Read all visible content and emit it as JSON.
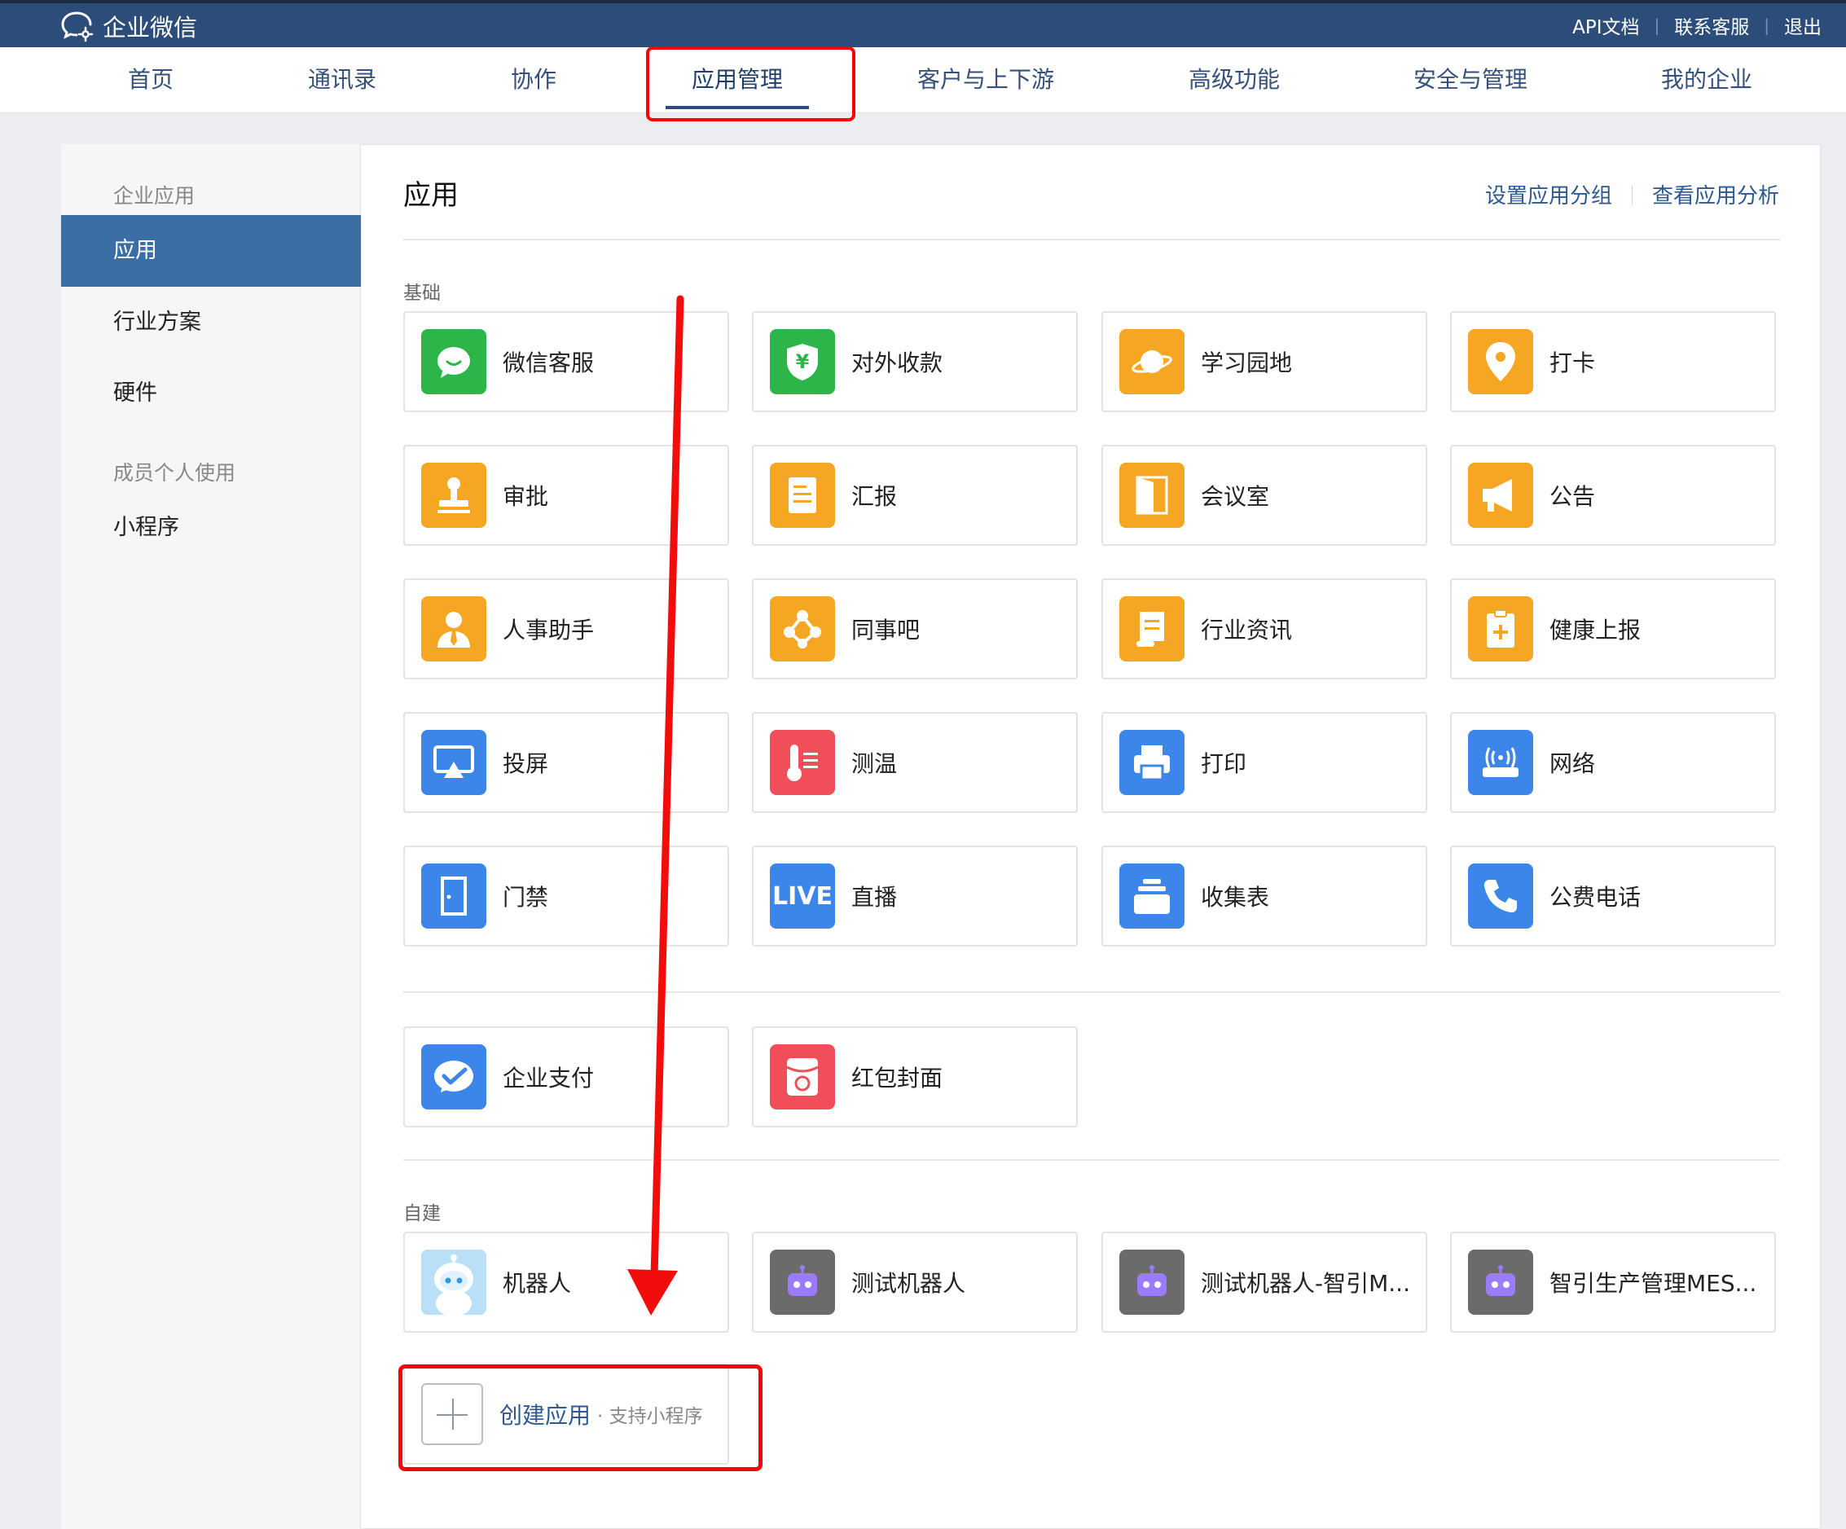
{
  "brand": {
    "name": "企业微信"
  },
  "top_links": [
    "API文档",
    "联系客服",
    "退出"
  ],
  "nav": {
    "items": [
      "首页",
      "通讯录",
      "协作",
      "应用管理",
      "客户与上下游",
      "高级功能",
      "安全与管理",
      "我的企业"
    ],
    "active": "应用管理"
  },
  "sidebar": {
    "group1": "企业应用",
    "items1": [
      "应用",
      "行业方案",
      "硬件"
    ],
    "group2": "成员个人使用",
    "items2": [
      "小程序"
    ],
    "active": "应用"
  },
  "main": {
    "title": "应用",
    "actions": [
      "设置应用分组",
      "查看应用分析"
    ],
    "basic_label": "基础",
    "basic_apps": [
      {
        "name": "微信客服",
        "icon": "chat-bubble-icon",
        "color": "#2cb64a"
      },
      {
        "name": "对外收款",
        "icon": "yuan-shield-icon",
        "color": "#2cb64a"
      },
      {
        "name": "学习园地",
        "icon": "planet-icon",
        "color": "#f5a623"
      },
      {
        "name": "打卡",
        "icon": "location-pin-icon",
        "color": "#f5a623"
      },
      {
        "name": "审批",
        "icon": "stamp-icon",
        "color": "#f5a623"
      },
      {
        "name": "汇报",
        "icon": "report-doc-icon",
        "color": "#f5a623"
      },
      {
        "name": "会议室",
        "icon": "door-open-icon",
        "color": "#f5a623"
      },
      {
        "name": "公告",
        "icon": "megaphone-icon",
        "color": "#f5a623"
      },
      {
        "name": "人事助手",
        "icon": "person-tie-icon",
        "color": "#f5a623"
      },
      {
        "name": "同事吧",
        "icon": "network-nodes-icon",
        "color": "#f5a623"
      },
      {
        "name": "行业资讯",
        "icon": "news-scroll-icon",
        "color": "#f5a623"
      },
      {
        "name": "健康上报",
        "icon": "clipboard-plus-icon",
        "color": "#f5a623"
      },
      {
        "name": "投屏",
        "icon": "screen-cast-icon",
        "color": "#3b86e8"
      },
      {
        "name": "测温",
        "icon": "thermometer-icon",
        "color": "#f04f5a"
      },
      {
        "name": "打印",
        "icon": "printer-icon",
        "color": "#3b86e8"
      },
      {
        "name": "网络",
        "icon": "router-icon",
        "color": "#3b86e8"
      },
      {
        "name": "门禁",
        "icon": "door-icon",
        "color": "#3b86e8"
      },
      {
        "name": "直播",
        "icon": "live-icon",
        "color": "#3b86e8",
        "label": "LIVE"
      },
      {
        "name": "收集表",
        "icon": "stack-tray-icon",
        "color": "#3b86e8"
      },
      {
        "name": "公费电话",
        "icon": "phone-icon",
        "color": "#3b86e8"
      }
    ],
    "extra_apps": [
      {
        "name": "企业支付",
        "icon": "wechat-pay-icon",
        "color": "#3b86e8"
      },
      {
        "name": "红包封面",
        "icon": "red-envelope-icon",
        "color": "#f04f5a"
      }
    ],
    "custom_label": "自建",
    "custom_apps": [
      {
        "name": "机器人",
        "icon": "robot-avatar-icon",
        "color": "#7cc3f0"
      },
      {
        "name": "测试机器人",
        "icon": "robot-icon",
        "color": "#6b6b6b"
      },
      {
        "name": "测试机器人-智引M...",
        "icon": "robot-icon",
        "color": "#6b6b6b"
      },
      {
        "name": "智引生产管理MES...",
        "icon": "robot-icon",
        "color": "#6b6b6b"
      }
    ],
    "create": {
      "label": "创建应用",
      "sub": "· 支持小程序"
    }
  }
}
